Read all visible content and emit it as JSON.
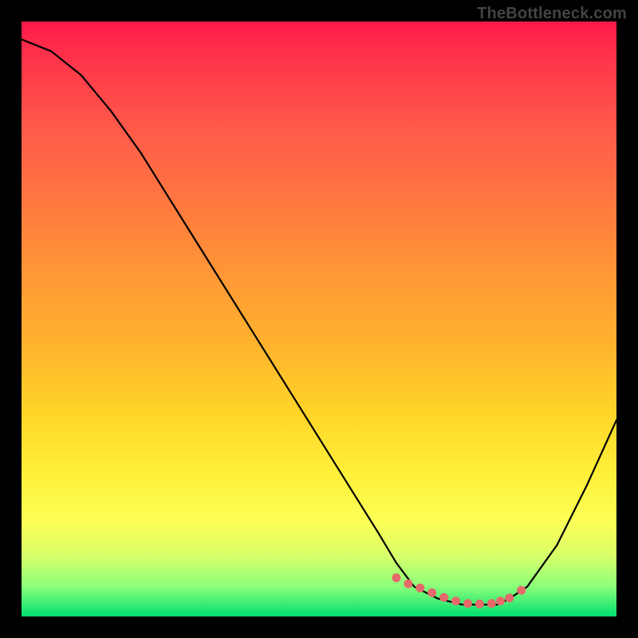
{
  "watermark": "TheBottleneck.com",
  "chart_data": {
    "type": "line",
    "title": "",
    "xlabel": "",
    "ylabel": "",
    "xlim": [
      0,
      100
    ],
    "ylim": [
      0,
      100
    ],
    "series": [
      {
        "name": "curve",
        "x": [
          0,
          5,
          10,
          15,
          20,
          25,
          30,
          35,
          40,
          45,
          50,
          55,
          60,
          63,
          66,
          70,
          74,
          78,
          80,
          82,
          85,
          90,
          95,
          100
        ],
        "y": [
          97,
          95,
          91,
          85,
          78,
          70,
          62,
          54,
          46,
          38,
          30,
          22,
          14,
          9,
          5,
          3,
          2,
          2,
          2,
          3,
          5,
          12,
          22,
          33
        ]
      }
    ],
    "highlight": {
      "name": "dotted-range",
      "x": [
        63,
        65,
        67,
        69,
        71,
        73,
        75,
        77,
        79,
        80.5,
        82,
        84
      ],
      "y": [
        6.5,
        5.5,
        4.8,
        4.0,
        3.2,
        2.6,
        2.2,
        2.1,
        2.2,
        2.6,
        3.1,
        4.4
      ]
    },
    "background": {
      "type": "vertical-gradient",
      "stops": [
        {
          "pos": 0,
          "color": "#ff1a4a"
        },
        {
          "pos": 0.5,
          "color": "#ffb22e"
        },
        {
          "pos": 0.8,
          "color": "#fff03a"
        },
        {
          "pos": 1.0,
          "color": "#00e070"
        }
      ]
    }
  }
}
